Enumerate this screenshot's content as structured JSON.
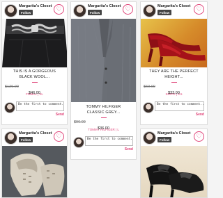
{
  "cards": [
    {
      "seller": "Margarita's Closet",
      "follow_label": "Follow",
      "title": "THIS IS A GORGEOUS BLACK WOOL...",
      "original_price": "$126.00",
      "price": "$46.00",
      "brand": "FRIBAL | XL",
      "comment_placeholder": "Be the first to comment...",
      "send_label": "Send"
    },
    {
      "seller": "Margarita's Closet",
      "follow_label": "Follow",
      "title": "TOMMY HILFIGER CLASSIC GREY...",
      "original_price": "$96.00",
      "price": "$36.00",
      "brand": "TOMMY HILFIGER | L",
      "comment_placeholder": "Be the first to comment...",
      "send_label": "Send"
    },
    {
      "seller": "Margarita's Closet",
      "follow_label": "Follow",
      "title": "THEY ARE THE PERFECT HEIGHT...",
      "original_price": "$60.00",
      "price": "$33.00",
      "brand": "SIRPO | 8.5",
      "comment_placeholder": "Be the first to comment...",
      "send_label": "Send"
    },
    {
      "seller": "Margarita's Closet",
      "follow_label": "Follow"
    },
    {
      "seller": "Margarita's Closet",
      "follow_label": "Follow"
    }
  ],
  "icons": {
    "like": "heart-icon"
  },
  "colors": {
    "accent": "#e0457a",
    "follow_button": "#444444"
  }
}
